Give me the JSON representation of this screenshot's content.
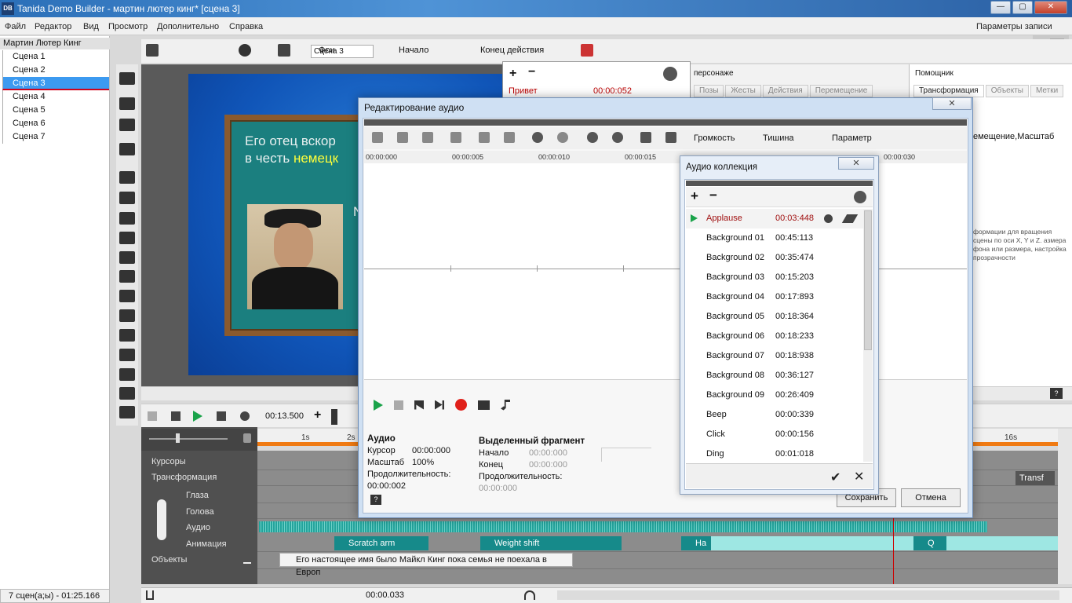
{
  "window": {
    "app_icon": "DB",
    "title": "Tanida Demo Builder - мартин лютер кинг* [сцена 3]",
    "min": "—",
    "max": "▢",
    "close": "✕"
  },
  "menu": {
    "items": [
      "Файл",
      "Редактор",
      "Вид",
      "Просмотр",
      "Дополнительно",
      "Справка"
    ],
    "right": "Параметры записи"
  },
  "scenes": {
    "project": "Мартин Лютер Кинг",
    "items": [
      "Сцена 1",
      "Сцена 2",
      "Сцена 3",
      "Сцена 4",
      "Сцена 5",
      "Сцена 6",
      "Сцена 7"
    ],
    "selected_index": 2,
    "status": "7 сцен(а;ы) - 01:25.166"
  },
  "toolbar": {
    "scene_name": "Сцена 3",
    "background": "Фон",
    "start": "Начало",
    "action_end": "Конец действия"
  },
  "slide": {
    "line1": "Его отец вскор",
    "line2_prefix": "в честь ",
    "line2_highlight": "немецк",
    "side_letter": "N"
  },
  "objects_panel": {
    "add": "+",
    "remove": "−",
    "row_name": "Привет",
    "row_time": "00:00:052"
  },
  "character_panel": {
    "title": "персонаже",
    "tabs": [
      "Позы",
      "Жесты",
      "Действия",
      "Перемещение"
    ]
  },
  "helper": {
    "title": "Помощник",
    "tabs": [
      "Трансформация",
      "Объекты",
      "Метки"
    ],
    "text1": "емещение,Масштаб",
    "text2": "формации для вращения сцены по оси X, Y и Z. азмера фона или размера, настройка прозрачности",
    "help": "?"
  },
  "timeline": {
    "time": "00:13.500",
    "plus": "+",
    "rows": {
      "cursors": "Курсоры",
      "transform": "Трансформация",
      "eyes": "Глаза",
      "head": "Голова",
      "audio": "Аудио",
      "animation": "Анимация",
      "objects": "Объекты"
    },
    "ruler": [
      "1s",
      "2s",
      "16s"
    ],
    "anim_blocks": [
      "Scratch arm",
      "Weight shift",
      "Ha",
      "Q"
    ],
    "text_object": "Его настоящее имя было Майкл Кинг пока семья не поехала в Европ",
    "transf_chip": "Transf",
    "status_time": "00:00.033"
  },
  "audio_editor": {
    "title": "Редактирование аудио",
    "close": "✕",
    "dropdowns": [
      "Громкость",
      "Тишина",
      "Параметр"
    ],
    "ruler": [
      "00:00:000",
      "00:00:005",
      "00:00:010",
      "00:00:015",
      "00:00:030"
    ],
    "info": {
      "heading": "Аудио",
      "cursor_label": "Курсор",
      "cursor_value": "00:00:000",
      "scale_label": "Масштаб",
      "scale_value": "100%",
      "duration_label": "Продолжительность:",
      "duration_value": "00:00:002"
    },
    "selection": {
      "heading": "Выделенный фрагмент",
      "start_label": "Начало",
      "start_value": "00:00:000",
      "end_label": "Конец",
      "end_value": "00:00:000",
      "duration_label": "Продолжительность:",
      "duration_value": "00:00:000"
    },
    "help": "?",
    "save": "Сохранить",
    "cancel": "Отмена"
  },
  "audio_collection": {
    "title": "Аудио коллекция",
    "close": "✕",
    "add": "+",
    "remove": "−",
    "items": [
      {
        "name": "Applause",
        "time": "00:03:448"
      },
      {
        "name": "Background 01",
        "time": "00:45:113"
      },
      {
        "name": "Background 02",
        "time": "00:35:474"
      },
      {
        "name": "Background 03",
        "time": "00:15:203"
      },
      {
        "name": "Background 04",
        "time": "00:17:893"
      },
      {
        "name": "Background 05",
        "time": "00:18:364"
      },
      {
        "name": "Background 06",
        "time": "00:18:233"
      },
      {
        "name": "Background 07",
        "time": "00:18:938"
      },
      {
        "name": "Background 08",
        "time": "00:36:127"
      },
      {
        "name": "Background 09",
        "time": "00:26:409"
      },
      {
        "name": "Beep",
        "time": "00:00:339"
      },
      {
        "name": "Click",
        "time": "00:00:156"
      },
      {
        "name": "Ding",
        "time": "00:01:018"
      }
    ],
    "ok": "✔",
    "cancel": "✕"
  },
  "colors": {
    "accent": "#3c9af0",
    "play": "#1aa34a",
    "record": "#e0201a",
    "timeline_orange": "#f07a12"
  }
}
